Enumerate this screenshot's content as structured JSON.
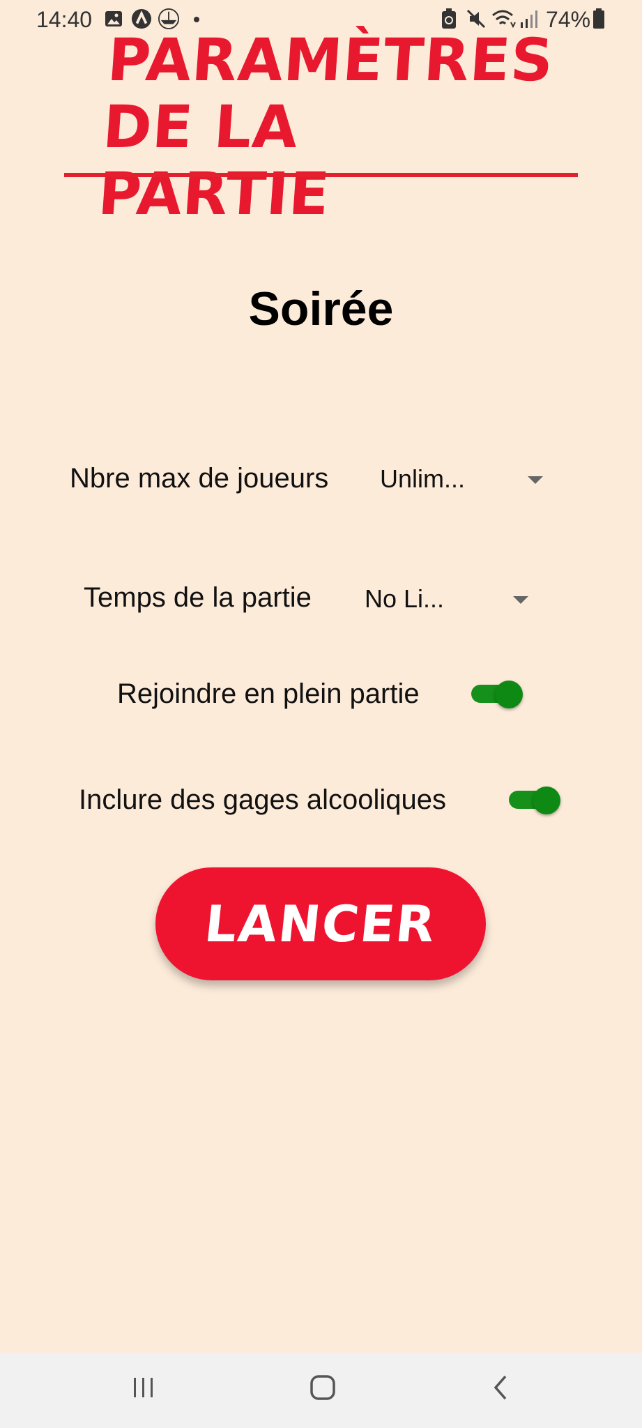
{
  "status_bar": {
    "time": "14:40",
    "battery": "74%",
    "icons": [
      "image-icon",
      "app-a-icon",
      "ship-icon",
      "notification-dot",
      "battery-saver-icon",
      "mute-icon",
      "wifi-icon",
      "signal-icon",
      "battery-icon"
    ]
  },
  "header": {
    "title_line1": "Paramètres",
    "title_line2": "de la partie"
  },
  "mode": "Soirée",
  "settings": {
    "max_players": {
      "label": "Nbre max de joueurs",
      "value": "Unlim..."
    },
    "game_time": {
      "label": "Temps de la partie",
      "value": "No Li..."
    },
    "join_midgame": {
      "label": "Rejoindre en plein partie",
      "enabled": true
    },
    "alcohol_dares": {
      "label": "Inclure des gages alcooliques",
      "enabled": true
    }
  },
  "launch_button": "LANCER",
  "colors": {
    "background": "#FDEBDA",
    "accent": "#EE1430",
    "toggle_on": "#15901A"
  },
  "nav_bar": [
    "recent-apps-icon",
    "home-icon",
    "back-icon"
  ]
}
